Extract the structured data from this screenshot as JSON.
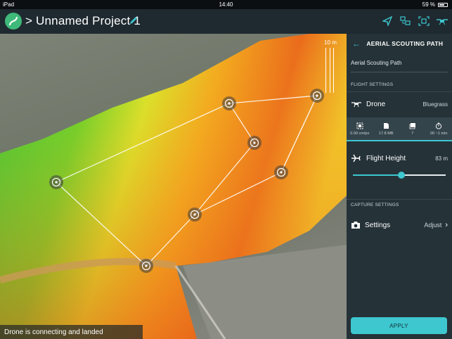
{
  "status_bar": {
    "carrier": "iPad",
    "time": "14:40",
    "battery": "59 %",
    "battery_level": 0.59
  },
  "app_bar": {
    "title": "> Unnamed Project 1",
    "icons": [
      "send-icon",
      "map-layers-icon",
      "frame-icon",
      "drone-icon"
    ]
  },
  "map": {
    "scale_label": "10 m",
    "status_message": "Drone is connecting and landed",
    "colors": {
      "high": "#2ecc2e",
      "mid": "#e8e82a",
      "low": "#e8671d",
      "path": "#ffffff"
    }
  },
  "panel": {
    "title": "AERIAL SCOUTING PATH",
    "path_name": "Aerial Scouting Path",
    "flight_settings_header": "FLIGHT SETTINGS",
    "drone_label": "Drone",
    "drone_value": "Bluegrass",
    "stats": [
      {
        "icon": "resolution-icon",
        "value": "0.00 cm/px"
      },
      {
        "icon": "sd-card-icon",
        "value": "17.8 MB"
      },
      {
        "icon": "photos-icon",
        "value": "7"
      },
      {
        "icon": "timer-icon",
        "value": "00 ~1 min"
      }
    ],
    "flight_height_label": "Flight Height",
    "flight_height_value": "83 m",
    "flight_height_slider_fraction": 0.52,
    "capture_settings_header": "CAPTURE SETTINGS",
    "settings_label": "Settings",
    "settings_value": "Adjust",
    "apply_label": "APPLY",
    "accent": "#3ec7cf"
  }
}
